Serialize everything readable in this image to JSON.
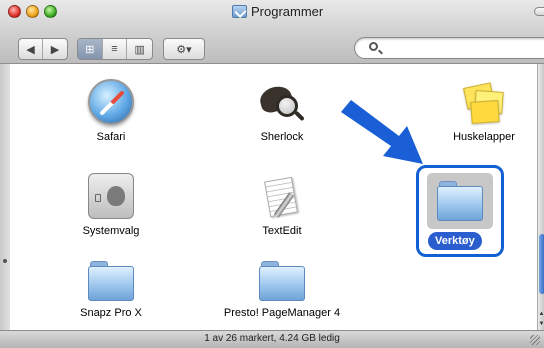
{
  "window": {
    "title": "Programmer"
  },
  "toolbar": {
    "back_label": "◀",
    "forward_label": "▶",
    "view_icons_label": "⊞",
    "view_list_label": "≡",
    "view_columns_label": "▥",
    "action_label": "⚙▾",
    "search_placeholder": ""
  },
  "items": [
    {
      "label": "Safari",
      "icon": "safari-icon"
    },
    {
      "label": "Sherlock",
      "icon": "sherlock-icon"
    },
    {
      "label": "Huskelapper",
      "icon": "stickies-icon"
    },
    {
      "label": "Systemvalg",
      "icon": "system-preferences-icon"
    },
    {
      "label": "TextEdit",
      "icon": "textedit-icon"
    },
    {
      "label": "Verktøy",
      "icon": "folder-icon",
      "selected": true
    },
    {
      "label": "Snapz Pro X",
      "icon": "folder-icon"
    },
    {
      "label": "Presto! PageManager 4",
      "icon": "folder-icon"
    }
  ],
  "status": {
    "text": "1 av 26 markert, 4.24 GB ledig"
  },
  "colors": {
    "selection": "#1261d4",
    "arrow": "#1a5fd6",
    "label_highlight": "#2a5ecf"
  }
}
